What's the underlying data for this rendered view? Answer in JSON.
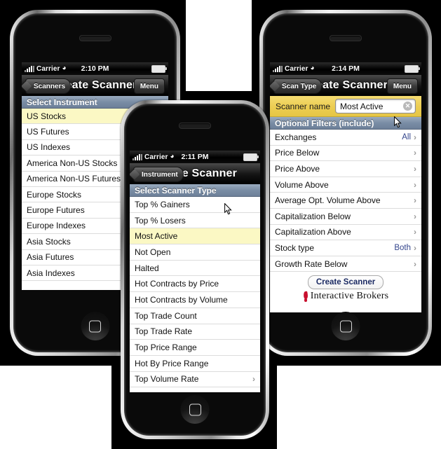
{
  "phone1": {
    "status": {
      "carrier": "Carrier",
      "time": "2:10 PM",
      "wifi": "wifi-icon"
    },
    "nav": {
      "back": "Scanners",
      "title": "Create Scanner",
      "menu": "Menu"
    },
    "section_header": "Select Instrument",
    "items": [
      {
        "label": "US Stocks",
        "selected": true
      },
      {
        "label": "US Futures",
        "selected": false
      },
      {
        "label": "US Indexes",
        "selected": false
      },
      {
        "label": "America Non-US Stocks",
        "selected": false
      },
      {
        "label": "America Non-US Futures",
        "selected": false
      },
      {
        "label": "Europe Stocks",
        "selected": false
      },
      {
        "label": "Europe Futures",
        "selected": false
      },
      {
        "label": "Europe Indexes",
        "selected": false
      },
      {
        "label": "Asia Stocks",
        "selected": false
      },
      {
        "label": "Asia Futures",
        "selected": false
      },
      {
        "label": "Asia Indexes",
        "selected": false
      }
    ]
  },
  "phone2": {
    "status": {
      "carrier": "Carrier",
      "time": "2:11 PM",
      "wifi": "wifi-icon"
    },
    "nav": {
      "back": "Instrument",
      "title": "Create Scanner",
      "menu": "Menu"
    },
    "section_header": "Select Scanner Type",
    "items": [
      {
        "label": "Top % Gainers",
        "selected": false
      },
      {
        "label": "Top % Losers",
        "selected": false
      },
      {
        "label": "Most Active",
        "selected": true
      },
      {
        "label": "Not Open",
        "selected": false
      },
      {
        "label": "Halted",
        "selected": false
      },
      {
        "label": "Hot Contracts by Price",
        "selected": false
      },
      {
        "label": "Hot Contracts by Volume",
        "selected": false
      },
      {
        "label": "Top Trade Count",
        "selected": false
      },
      {
        "label": "Top Trade Rate",
        "selected": false
      },
      {
        "label": "Top Price Range",
        "selected": false
      },
      {
        "label": "Hot By Price Range",
        "selected": false
      },
      {
        "label": "Top Volume Rate",
        "selected": false,
        "chevron": true
      }
    ]
  },
  "phone3": {
    "status": {
      "carrier": "Carrier",
      "time": "2:14 PM",
      "wifi": "wifi-icon"
    },
    "nav": {
      "back": "Scan Type",
      "title": "Create Scanner",
      "menu": "Menu"
    },
    "scanner_name_label": "Scanner name",
    "scanner_name_value": "Most Active",
    "scanner_name_placeholder": "Scanner name",
    "clear_icon": "clear-circle-icon",
    "section_header": "Optional Filters (include)",
    "filters": [
      {
        "label": "Exchanges",
        "value": "All"
      },
      {
        "label": "Price Below",
        "value": ""
      },
      {
        "label": "Price Above",
        "value": ""
      },
      {
        "label": "Volume Above",
        "value": ""
      },
      {
        "label": "Average Opt. Volume Above",
        "value": ""
      },
      {
        "label": "Capitalization Below",
        "value": ""
      },
      {
        "label": "Capitalization Above",
        "value": ""
      },
      {
        "label": "Stock type",
        "value": "Both"
      },
      {
        "label": "Growth Rate Below",
        "value": ""
      }
    ],
    "create_button": "Create Scanner",
    "brand": "Interactive Brokers"
  },
  "colors": {
    "accent_value": "#33458c",
    "section_header": "#7a8da5",
    "name_bar": "#eccd52",
    "row_selected": "#fbf8c4",
    "brand_red": "#c8102e"
  }
}
